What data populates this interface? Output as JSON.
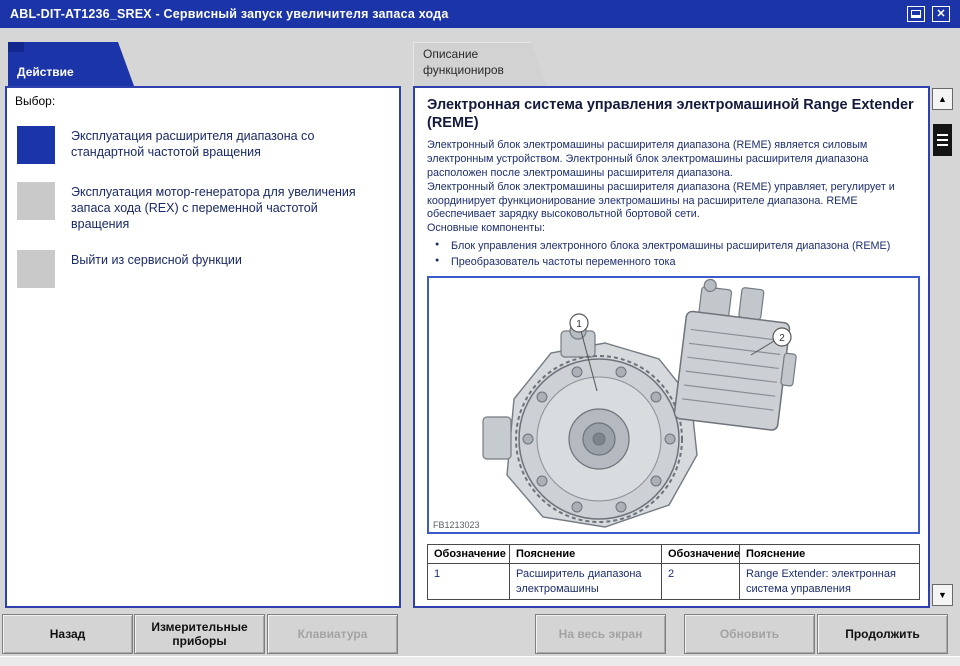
{
  "colors": {
    "accent_blue": "#1b34a8",
    "panel_border": "#2e41ad",
    "disabled_text": "#a3a3a3",
    "body_text": "#1c2e6e"
  },
  "title_bar": {
    "title": "ABL-DIT-AT1236_SREX  -  Сервисный запуск увеличителя запаса хода",
    "icons": [
      "window-restore-icon",
      "close-icon"
    ]
  },
  "tabs": [
    {
      "label": "Действие",
      "active": true
    },
    {
      "label": "Описание функциониров",
      "active": false
    }
  ],
  "left_panel": {
    "label": "Выбор:",
    "options": [
      {
        "label": "Эксплуатация расширителя диапазона со стандартной частотой вращения",
        "selected": true
      },
      {
        "label": "Эксплуатация мотор-генератора для увеличения запаса хода (REX) с переменной частотой вращения",
        "selected": false
      },
      {
        "label": "Выйти из сервисной функции",
        "selected": false
      }
    ]
  },
  "content": {
    "heading": "Электронная система управления электромашиной Range Extender (REME)",
    "paragraphs": [
      "Электронный блок электромашины расширителя диапазона (REME) является силовым электронным устройством. Электронный блок электромашины расширителя диапазона расположен после электромашины расширителя диапазона.",
      "Электронный блок электромашины расширителя диапазона (REME) управляет, регулирует и координирует функционирование электромашины на расширителе диапазона. REME обеспечивает зарядку высоковольтной бортовой сети.",
      "Основные компоненты:"
    ],
    "bullets": [
      "Блок управления электронного блока электромашины расширителя диапазона (REME)",
      "Преобразователь частоты переменного тока"
    ],
    "figure": {
      "code": "FB1213023",
      "callouts": [
        "1",
        "2"
      ]
    },
    "table": {
      "headers": [
        "Обозначение",
        "Пояснение",
        "Обозначение",
        "Пояснение"
      ],
      "rows": [
        [
          "1",
          "Расширитель диапазона электромашины",
          "2",
          "Range Extender: электронная система управления"
        ]
      ]
    }
  },
  "toolbar": {
    "buttons": [
      {
        "label": "Назад",
        "enabled": true
      },
      {
        "label": "Измерительные приборы",
        "enabled": true
      },
      {
        "label": "Клавиатура",
        "enabled": false
      },
      {
        "label": "На весь экран",
        "enabled": false
      },
      {
        "label": "Обновить",
        "enabled": false
      },
      {
        "label": "Продолжить",
        "enabled": true
      }
    ]
  }
}
